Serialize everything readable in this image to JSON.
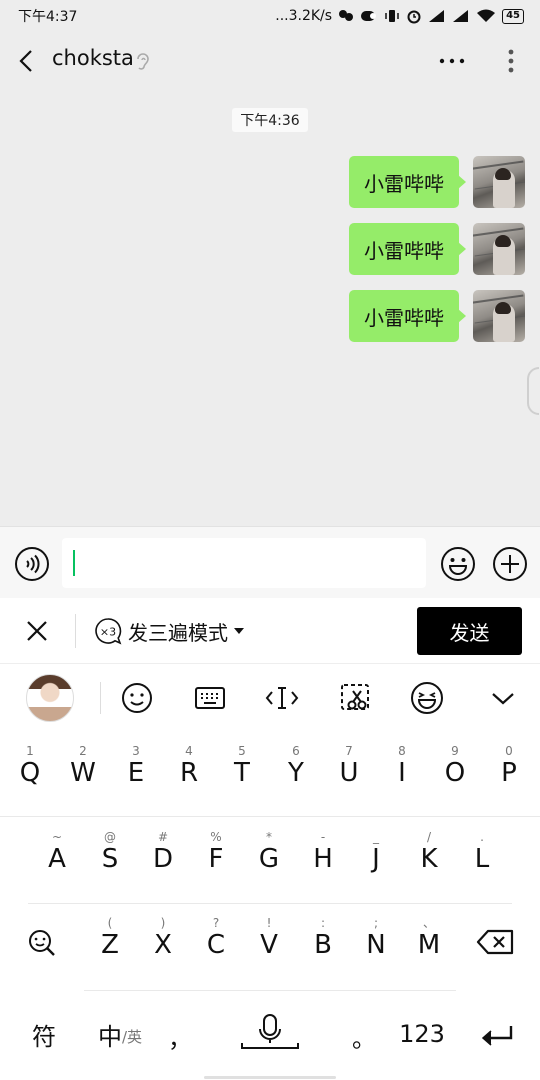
{
  "status_bar": {
    "time": "下午4:37",
    "net_speed": "...3.2K/s",
    "battery": "45"
  },
  "header": {
    "title": "choksta"
  },
  "chat": {
    "timestamp": "下午4:36",
    "messages": [
      {
        "text": "小雷哔哔"
      },
      {
        "text": "小雷哔哔"
      },
      {
        "text": "小雷哔哔"
      }
    ]
  },
  "input": {
    "value": ""
  },
  "keyboard_top": {
    "mode_label": "发三遍模式",
    "mode_badge": "×3",
    "send_label": "发送"
  },
  "keyboard": {
    "row1": [
      {
        "sub": "1",
        "main": "Q"
      },
      {
        "sub": "2",
        "main": "W"
      },
      {
        "sub": "3",
        "main": "E"
      },
      {
        "sub": "4",
        "main": "R"
      },
      {
        "sub": "5",
        "main": "T"
      },
      {
        "sub": "6",
        "main": "Y"
      },
      {
        "sub": "7",
        "main": "U"
      },
      {
        "sub": "8",
        "main": "I"
      },
      {
        "sub": "9",
        "main": "O"
      },
      {
        "sub": "0",
        "main": "P"
      }
    ],
    "row2": [
      {
        "sub": "~",
        "main": "A"
      },
      {
        "sub": "@",
        "main": "S"
      },
      {
        "sub": "#",
        "main": "D"
      },
      {
        "sub": "%",
        "main": "F"
      },
      {
        "sub": "*",
        "main": "G"
      },
      {
        "sub": "-",
        "main": "H"
      },
      {
        "sub": "_",
        "main": "J"
      },
      {
        "sub": "/",
        "main": "K"
      },
      {
        "sub": ".",
        "main": "L"
      }
    ],
    "row3": [
      {
        "sub": "(",
        "main": "Z"
      },
      {
        "sub": ")",
        "main": "X"
      },
      {
        "sub": "?",
        "main": "C"
      },
      {
        "sub": "!",
        "main": "V"
      },
      {
        "sub": ":",
        "main": "B"
      },
      {
        "sub": ";",
        "main": "N"
      },
      {
        "sub": "、",
        "main": "M"
      }
    ],
    "bottom": {
      "symbols": "符",
      "lang_main": "中",
      "lang_sub": "/英",
      "comma": "，",
      "period": "。",
      "numbers": "123"
    }
  }
}
